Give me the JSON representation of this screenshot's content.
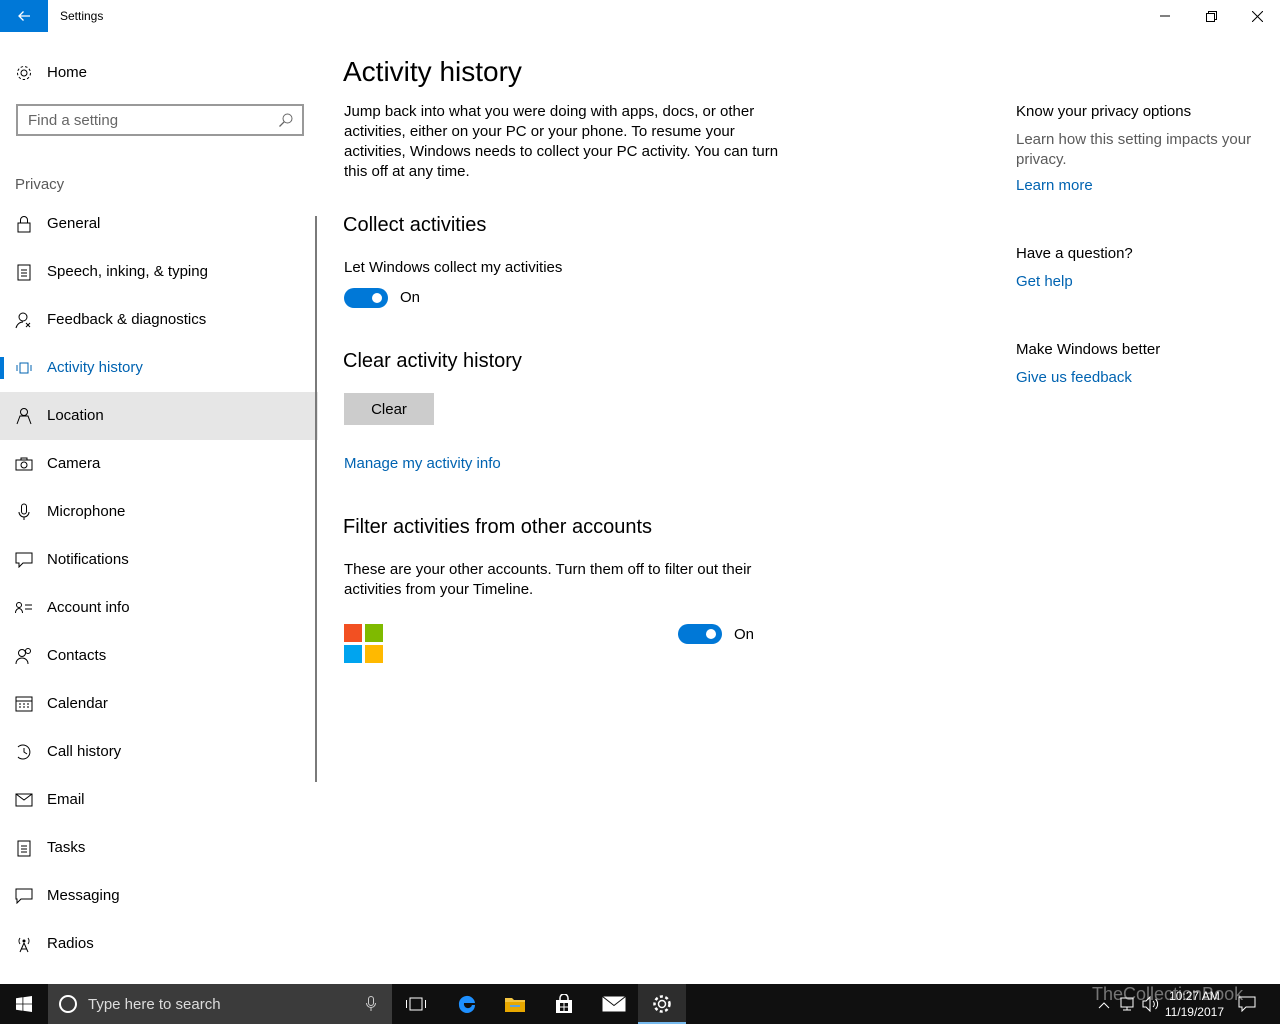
{
  "window": {
    "title": "Settings"
  },
  "sidebar": {
    "home_label": "Home",
    "search_placeholder": "Find a setting",
    "section_label": "Privacy",
    "items": [
      {
        "label": "General",
        "icon": "lock-icon"
      },
      {
        "label": "Speech, inking, & typing",
        "icon": "clipboard-icon"
      },
      {
        "label": "Feedback & diagnostics",
        "icon": "feedback-icon"
      },
      {
        "label": "Activity history",
        "icon": "activity-icon",
        "selected": true
      },
      {
        "label": "Location",
        "icon": "location-icon",
        "hover": true
      },
      {
        "label": "Camera",
        "icon": "camera-icon"
      },
      {
        "label": "Microphone",
        "icon": "microphone-icon"
      },
      {
        "label": "Notifications",
        "icon": "notifications-icon"
      },
      {
        "label": "Account info",
        "icon": "account-info-icon"
      },
      {
        "label": "Contacts",
        "icon": "contacts-icon"
      },
      {
        "label": "Calendar",
        "icon": "calendar-icon"
      },
      {
        "label": "Call history",
        "icon": "call-history-icon"
      },
      {
        "label": "Email",
        "icon": "email-icon"
      },
      {
        "label": "Tasks",
        "icon": "tasks-icon"
      },
      {
        "label": "Messaging",
        "icon": "messaging-icon"
      },
      {
        "label": "Radios",
        "icon": "radios-icon"
      }
    ]
  },
  "main": {
    "title": "Activity history",
    "description": "Jump back into what you were doing with apps, docs, or other activities, either on your PC or your phone. To resume your activities, Windows needs to collect your PC activity. You can turn this off at any time.",
    "collect": {
      "heading": "Collect activities",
      "label": "Let Windows collect my activities",
      "state": "On"
    },
    "clear": {
      "heading": "Clear activity history",
      "button": "Clear",
      "link": "Manage my activity info"
    },
    "filter": {
      "heading": "Filter activities from other accounts",
      "description": "These are your other accounts. Turn them off to filter out their activities from your Timeline.",
      "state": "On"
    }
  },
  "right_pane": {
    "privacy_heading": "Know your privacy options",
    "privacy_text": "Learn how this setting impacts your privacy.",
    "learn_more": "Learn more",
    "question_heading": "Have a question?",
    "get_help": "Get help",
    "better_heading": "Make Windows better",
    "feedback_link": "Give us feedback"
  },
  "taskbar": {
    "search_placeholder": "Type here to search",
    "time": "10:27 AM",
    "date": "11/19/2017",
    "watermark": "TheCollectionBook"
  },
  "colors": {
    "accent": "#0078d7",
    "link": "#0063b1",
    "taskbar": "#101010"
  }
}
